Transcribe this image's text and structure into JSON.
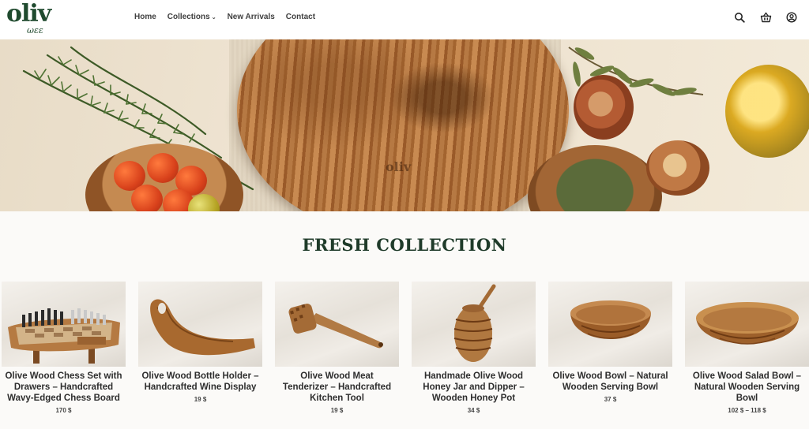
{
  "brand": {
    "logo_text": "oliv",
    "logo_sub": "ωεε"
  },
  "nav": {
    "items": [
      {
        "label": "Home",
        "name": "nav-home"
      },
      {
        "label": "Collections",
        "name": "nav-collections",
        "dropdown": true
      },
      {
        "label": "New Arrivals",
        "name": "nav-new-arrivals"
      },
      {
        "label": "Contact",
        "name": "nav-contact"
      }
    ]
  },
  "header_icons": [
    "search-icon",
    "basket-icon",
    "account-icon"
  ],
  "hero": {
    "board_logo": "oliv",
    "slides_total": 4,
    "active_slide": 4
  },
  "section": {
    "title": "FRESH COLLECTION"
  },
  "products": [
    {
      "name": "Olive Wood Chess Set with Drawers – Handcrafted Wavy-Edged Chess Board",
      "price": "170 $"
    },
    {
      "name": "Olive Wood Bottle Holder – Handcrafted Wine Display",
      "price": "19 $"
    },
    {
      "name": "Olive Wood Meat Tenderizer – Handcrafted Kitchen Tool",
      "price": "19 $"
    },
    {
      "name": "Handmade Olive Wood Honey Jar and Dipper – Wooden Honey Pot",
      "price": "34 $"
    },
    {
      "name": "Olive Wood Bowl – Natural Wooden Serving Bowl",
      "price": "37 $"
    },
    {
      "name": "Olive Wood Salad Bowl – Natural Wooden Serving Bowl",
      "price": "102 $ – 118 $"
    }
  ],
  "colors": {
    "brand_green": "#1f4a2e",
    "title_green": "#1f3b2a",
    "wood": "#b0733c"
  }
}
